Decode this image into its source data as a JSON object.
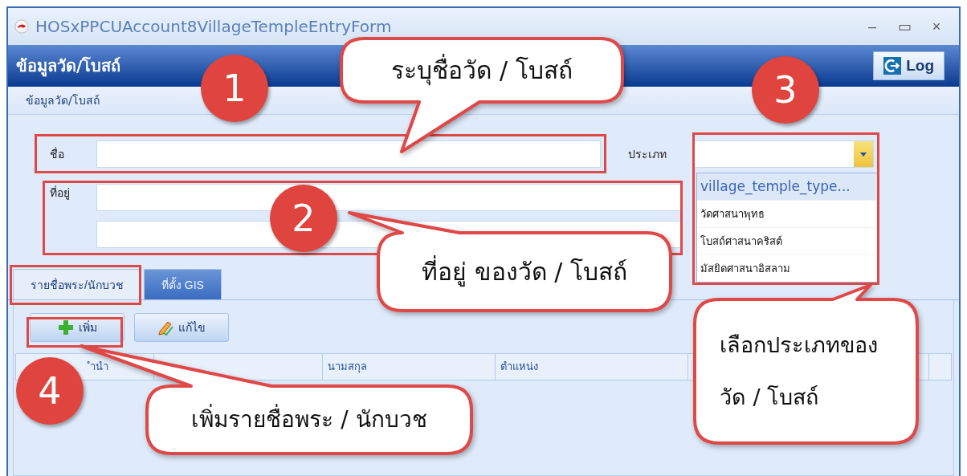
{
  "window": {
    "title": "HOSxPPCUAccount8VillageTempleEntryForm",
    "controls": [
      "–",
      "▭",
      "×"
    ]
  },
  "header": {
    "title": "ข้อมูลวัด/โบสถ์",
    "log_button": "Log"
  },
  "breadcrumb": "ข้อมูลวัด/โบสถ์",
  "form": {
    "name_label": "ชื่อ",
    "address_label": "ที่อยู่",
    "type_label": "ประเภท",
    "type_dropdown": {
      "header": "village_temple_type...",
      "options": [
        "วัดศาสนาพุทธ",
        "โบสถ์ศาสนาคริสต์",
        "มัสยิดศาสนาอิสลาม"
      ]
    }
  },
  "tabs": [
    {
      "label": "รายชื่อพระ/นักบวช",
      "selected": true
    },
    {
      "label": "ที่ตั้ง GIS",
      "selected": false
    }
  ],
  "toolbar": [
    {
      "label": "เพิ่ม",
      "kind": "add"
    },
    {
      "label": "แก้ไข",
      "kind": "edit"
    }
  ],
  "table": {
    "columns": [
      {
        "label": "ำนำ"
      },
      {},
      {
        "label": "นามสกุล"
      },
      {
        "label": "ตำแหน่ง"
      },
      {}
    ]
  },
  "callouts": [
    {
      "number": "1",
      "text": "ระบุชื่อวัด / โบสถ์"
    },
    {
      "number": "2",
      "text": "ที่อยู่ ของวัด / โบสถ์"
    },
    {
      "number": "3",
      "text": "เลือกประเภทของ วัด / โบสถ์"
    },
    {
      "number": "4",
      "text": "เพิ่มรายชื่อพระ / นักบวช"
    }
  ]
}
